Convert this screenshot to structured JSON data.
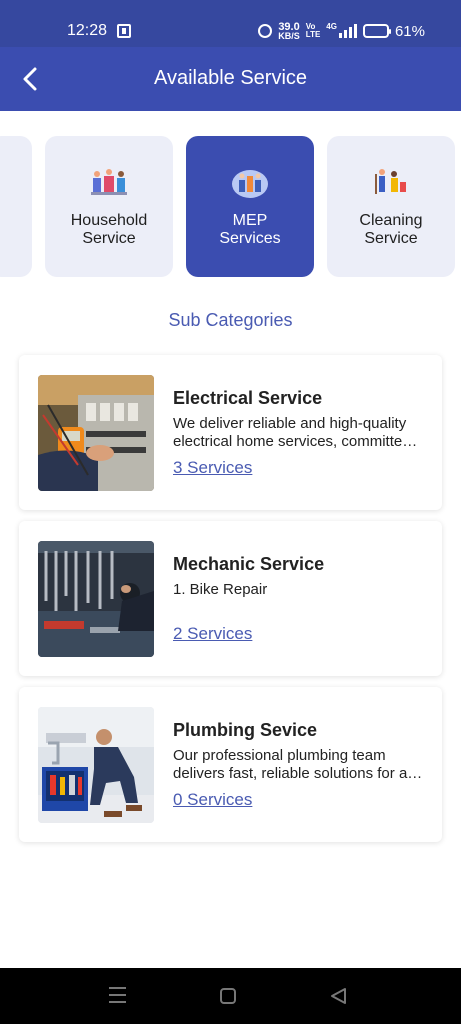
{
  "status_bar": {
    "time": "12:28",
    "net_speed_value": "39.0",
    "net_speed_unit": "KB/S",
    "volte_top": "Vo",
    "volte_bottom": "LTE",
    "signal_label": "4G",
    "battery": "61%"
  },
  "header": {
    "title": "Available Service"
  },
  "categories": [
    {
      "label": "",
      "icon": "category-icon",
      "active": false
    },
    {
      "label": "Household\nService",
      "icon": "household-icon",
      "active": false
    },
    {
      "label": "MEP\nServices",
      "icon": "mep-icon",
      "active": true
    },
    {
      "label": "Cleaning\nService",
      "icon": "cleaning-icon",
      "active": false
    }
  ],
  "sub_heading": "Sub Categories",
  "services": [
    {
      "title": "Electrical Service",
      "description": "We deliver reliable and high-quality electrical home services, committed to safety and quality.",
      "link": "3 Services",
      "image": "electrician-photo"
    },
    {
      "title": "Mechanic Service",
      "description": "1. Bike Repair",
      "link": "2 Services",
      "image": "mechanic-tools-photo"
    },
    {
      "title": "Plumbing Sevice",
      "description": "Our professional plumbing team delivers fast, reliable solutions for all your plumbing needs.",
      "link": "0 Services",
      "image": "plumber-photo"
    }
  ],
  "colors": {
    "primary": "#3b4db0",
    "status_bar": "#36489f",
    "card_bg": "#eceef8",
    "link": "#4a5bb2",
    "battery": "#f5b301"
  }
}
